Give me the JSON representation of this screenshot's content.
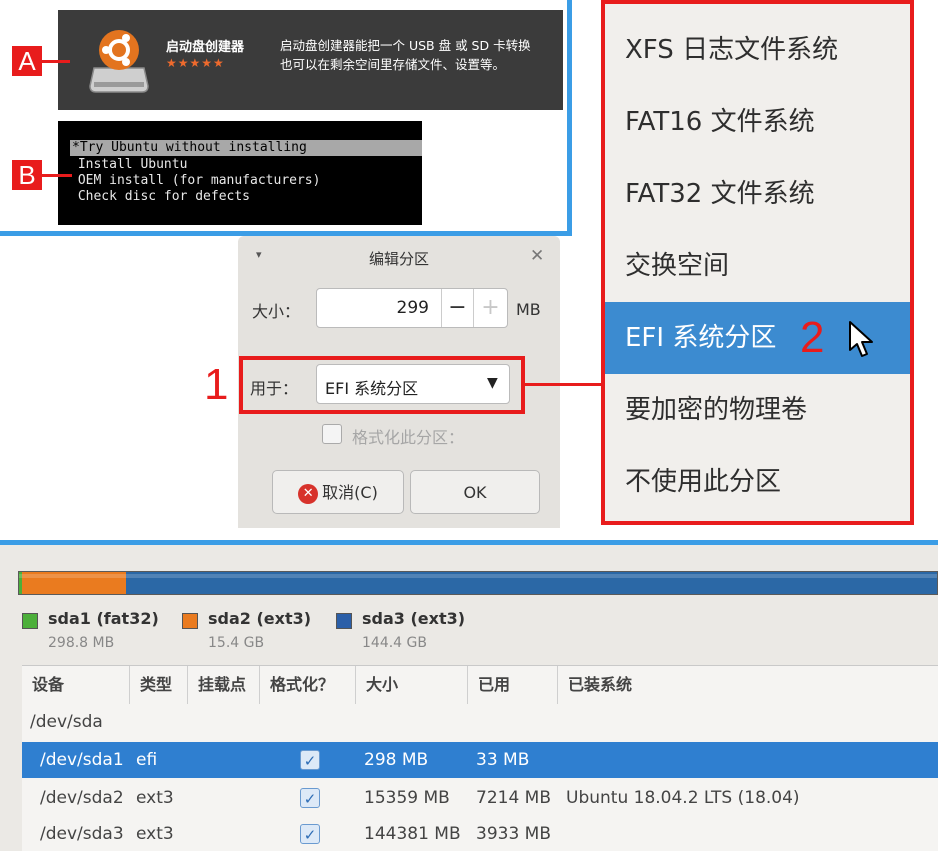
{
  "labels": {
    "a": "A",
    "b": "B",
    "n1": "1",
    "n2": "2"
  },
  "creator": {
    "name": "启动盘创建器",
    "stars": "★★★★★",
    "desc_line1": "启动盘创建器能把一个 USB 盘 或 SD 卡转换",
    "desc_line2": "也可以在剩余空间里存储文件、设置等。"
  },
  "boot_menu": {
    "items": [
      "*Try Ubuntu without installing",
      " Install Ubuntu",
      " OEM install (for manufacturers)",
      " Check disc for defects"
    ]
  },
  "dialog": {
    "title": "编辑分区",
    "menu_glyph": "▾",
    "close_glyph": "✕",
    "size_label": "大小：",
    "size_value": "299",
    "minus": "−",
    "plus": "+",
    "unit": "MB",
    "use_label": "用于：",
    "use_value": "EFI 系统分区",
    "use_arrow": "▼",
    "format_label": "格式化此分区：",
    "cancel_icon": "✕",
    "cancel_label": "取消(C)",
    "ok_label": "OK"
  },
  "dropdown": {
    "items": [
      "XFS 日志文件系统",
      "FAT16 文件系统",
      "FAT32 文件系统",
      "交换空间",
      "EFI 系统分区",
      "要加密的物理卷",
      "不使用此分区"
    ],
    "selected_index": 4
  },
  "partitions": {
    "legend": [
      {
        "name": "sda1 (fat32)",
        "size": "298.8 MB",
        "color": "#4caf3a"
      },
      {
        "name": "sda2 (ext3)",
        "size": "15.4 GB",
        "color": "#ea7b1f"
      },
      {
        "name": "sda3 (ext3)",
        "size": "144.4 GB",
        "color": "#2b5fa8"
      }
    ],
    "columns": [
      "设备",
      "类型",
      "挂载点",
      "格式化？",
      "大小",
      "已用",
      "已装系统"
    ],
    "disk_row": "/dev/sda",
    "rows": [
      {
        "device": "/dev/sda1",
        "type": "efi",
        "mount": "",
        "format": "✓",
        "size": "298 MB",
        "used": "33 MB",
        "system": "",
        "selected": true
      },
      {
        "device": "/dev/sda2",
        "type": "ext3",
        "mount": "",
        "format": "✓",
        "size": "15359 MB",
        "used": "7214 MB",
        "system": "Ubuntu 18.04.2 LTS (18.04)",
        "selected": false
      },
      {
        "device": "/dev/sda3",
        "type": "ext3",
        "mount": "",
        "format": "✓",
        "size": "144381 MB",
        "used": "3933 MB",
        "system": "",
        "selected": false
      }
    ]
  }
}
